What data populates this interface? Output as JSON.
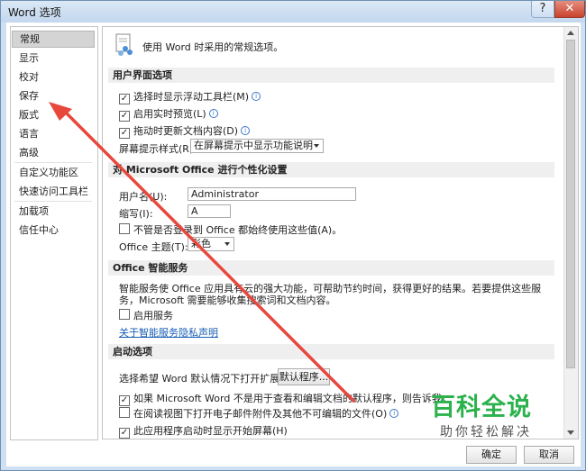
{
  "window": {
    "title": "Word 选项",
    "help": "?",
    "close": "✕"
  },
  "sidebar": {
    "items": [
      {
        "label": "常规"
      },
      {
        "label": "显示"
      },
      {
        "label": "校对"
      },
      {
        "label": "保存"
      },
      {
        "label": "版式"
      },
      {
        "label": "语言"
      },
      {
        "label": "高级"
      },
      {
        "label": "自定义功能区"
      },
      {
        "label": "快速访问工具栏"
      },
      {
        "label": "加载项"
      },
      {
        "label": "信任中心"
      }
    ]
  },
  "main": {
    "header": "使用 Word 时采用的常规选项。",
    "ui_section": {
      "title": "用户界面选项",
      "opt_minitoolbar": "选择时显示浮动工具栏(M)",
      "opt_livepreview": "启用实时预览(L)",
      "opt_dragupdate": "拖动时更新文档内容(D)",
      "tip_style_label": "屏幕提示样式(R):",
      "tip_style_value": "在屏幕提示中显示功能说明"
    },
    "personalize_section": {
      "title": "对 Microsoft Office 进行个性化设置",
      "username_label": "用户名(U):",
      "username_value": "Administrator",
      "initials_label": "缩写(I):",
      "initials_value": "A",
      "always_use": "不管是否登录到 Office 都始终使用这些值(A)。",
      "theme_label": "Office 主题(T):",
      "theme_value": "彩色"
    },
    "intel_section": {
      "title": "Office 智能服务",
      "desc": "智能服务使 Office 应用具有云的强大功能，可帮助节约时间，获得更好的结果。若要提供这些服务，Microsoft 需要能够收集搜索词和文档内容。",
      "enable": "启用服务",
      "about_link": "关于智能服务",
      "privacy_link": "隐私声明"
    },
    "startup_section": {
      "title": "启动选项",
      "ext_label": "选择希望 Word 默认情况下打开扩展名:",
      "default_programs_btn": "默认程序...",
      "tell_default": "如果 Microsoft Word 不是用于查看和编辑文档的默认程序，则告诉我。",
      "open_email_readmode": "在阅读视图下打开电子邮件附件及其他不可编辑的文件(O)",
      "show_start_screen": "此应用程序启动时显示开始屏幕(H)"
    }
  },
  "footer": {
    "ok": "确定",
    "cancel": "取消"
  },
  "watermark": {
    "title": "百科全说",
    "subtitle": "助你轻松解决"
  },
  "colors": {
    "annotation_arrow": "#e8473c",
    "watermark_green": "#2bb24c"
  }
}
